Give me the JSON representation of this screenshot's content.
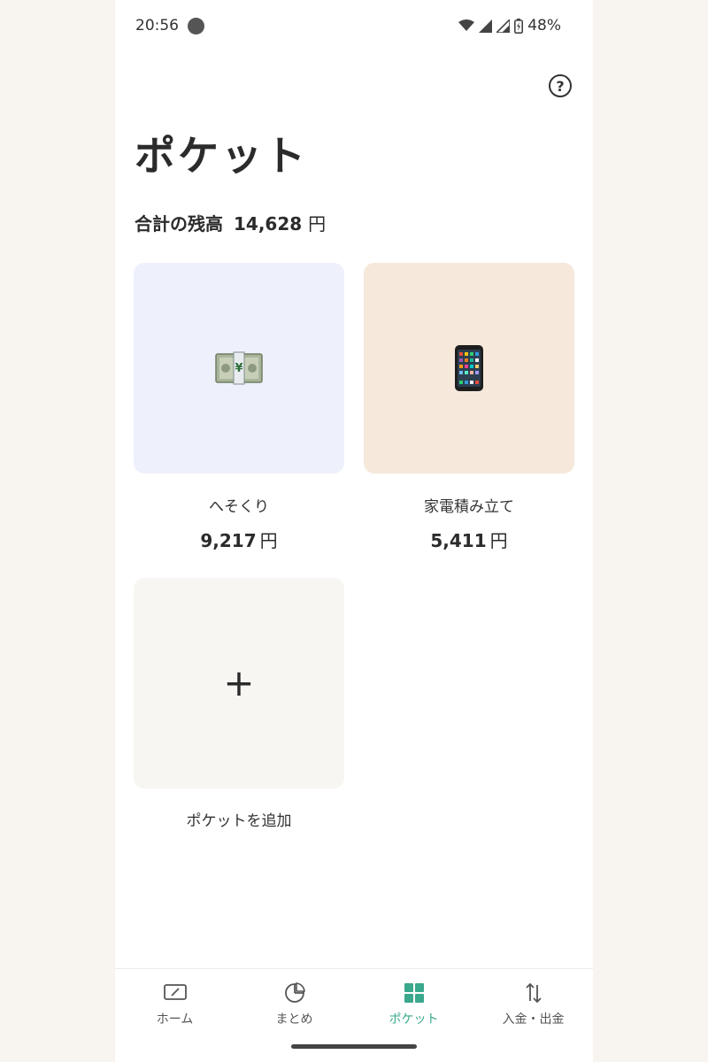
{
  "status_bar": {
    "time": "20:56",
    "battery": "48%",
    "icons": [
      "wifi-icon",
      "signal-icon",
      "signal-icon",
      "battery-icon"
    ]
  },
  "header": {
    "help_icon": "?",
    "title": "ポケット"
  },
  "summary": {
    "label": "合計の残高",
    "amount": "14,628",
    "unit": "円"
  },
  "pockets": [
    {
      "name": "へそくり",
      "amount": "9,217",
      "unit": "円",
      "icon": "money-icon",
      "color": "#eef1fc"
    },
    {
      "name": "家電積み立て",
      "amount": "5,411",
      "unit": "円",
      "icon": "smartphone-icon",
      "color": "#f6e8da"
    }
  ],
  "add_pocket": {
    "symbol": "+",
    "label": "ポケットを追加"
  },
  "bottom_nav": {
    "items": [
      {
        "label": "ホーム",
        "icon": "home-icon",
        "active": false
      },
      {
        "label": "まとめ",
        "icon": "pie-chart-icon",
        "active": false
      },
      {
        "label": "ポケット",
        "icon": "grid-icon",
        "active": true
      },
      {
        "label": "入金・出金",
        "icon": "transfer-icon",
        "active": false
      }
    ],
    "accent_color": "#3aa88c"
  }
}
